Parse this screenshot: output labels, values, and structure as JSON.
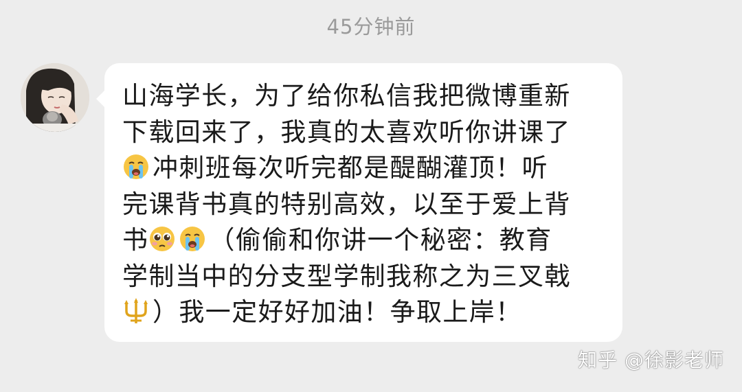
{
  "timestamp": "45分钟前",
  "message": {
    "line1": "山海学长，为了给你私信我把微博重新",
    "line2": "下载回来了，我真的太喜欢听你讲课了",
    "line3_emoji": "crying-face-emoji",
    "line3": "冲刺班每次听完都是醍醐灌顶！听",
    "line4": "完课背书真的特别高效，以至于爱上背",
    "line5_a": "书",
    "line5_emoji1": "pleading-face-emoji",
    "line5_emoji2": "crying-face-emoji",
    "line5_b": "（偷偷和你讲一个秘密：教育",
    "line6": "学制当中的分支型学制我称之为三叉戟",
    "line7_emoji": "trident-emoji",
    "line7": "）我一定好好加油！争取上岸！"
  },
  "watermark": "知乎 @徐影老师",
  "colors": {
    "background": "#ededed",
    "bubble": "#ffffff",
    "text": "#1a1a1a",
    "timestamp": "#9a9a9a"
  }
}
